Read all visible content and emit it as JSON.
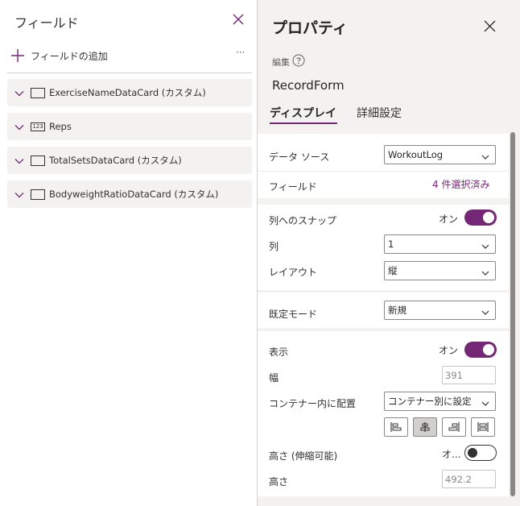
{
  "fields_pane": {
    "title": "フィールド",
    "add_field_label": "フィールドの追加",
    "more_label": "···",
    "fields": [
      {
        "name": "ExerciseNameDataCard (カスタム)",
        "type_icon": "text-field-icon"
      },
      {
        "name": "Reps",
        "type_icon": "number-field-icon",
        "badge": "123"
      },
      {
        "name": "TotalSetsDataCard (カスタム)",
        "type_icon": "text-field-icon"
      },
      {
        "name": "BodyweightRatioDataCard (カスタム)",
        "type_icon": "text-field-icon"
      }
    ]
  },
  "properties_pane": {
    "title": "プロパティ",
    "edit_label": "編集",
    "control_name": "RecordForm",
    "tabs": [
      {
        "label": "ディスプレイ",
        "active": true
      },
      {
        "label": "詳細設定",
        "active": false
      }
    ],
    "data_source": {
      "label": "データ ソース",
      "value": "WorkoutLog"
    },
    "fields": {
      "label": "フィールド",
      "link": "4 件選択済み"
    },
    "snap_to_columns": {
      "label": "列へのスナップ",
      "state_label": "オン",
      "on": true
    },
    "columns": {
      "label": "列",
      "value": "1"
    },
    "layout": {
      "label": "レイアウト",
      "value": "縦"
    },
    "default_mode": {
      "label": "既定モード",
      "value": "新規"
    },
    "visible": {
      "label": "表示",
      "state_label": "オン",
      "on": true
    },
    "width": {
      "label": "幅",
      "value": "391"
    },
    "align_in_container": {
      "label": "コンテナー内に配置",
      "value": "コンテナー別に設定"
    },
    "flexible_height": {
      "label": "高さ (伸縮可能)",
      "state_label": "オ...",
      "on": false
    },
    "height": {
      "label": "高さ",
      "value": "492.2"
    }
  },
  "colors": {
    "accent": "#742774",
    "pane_background": "#f3f2f1",
    "card_background": "#f3f2f1",
    "text": "#242424"
  }
}
